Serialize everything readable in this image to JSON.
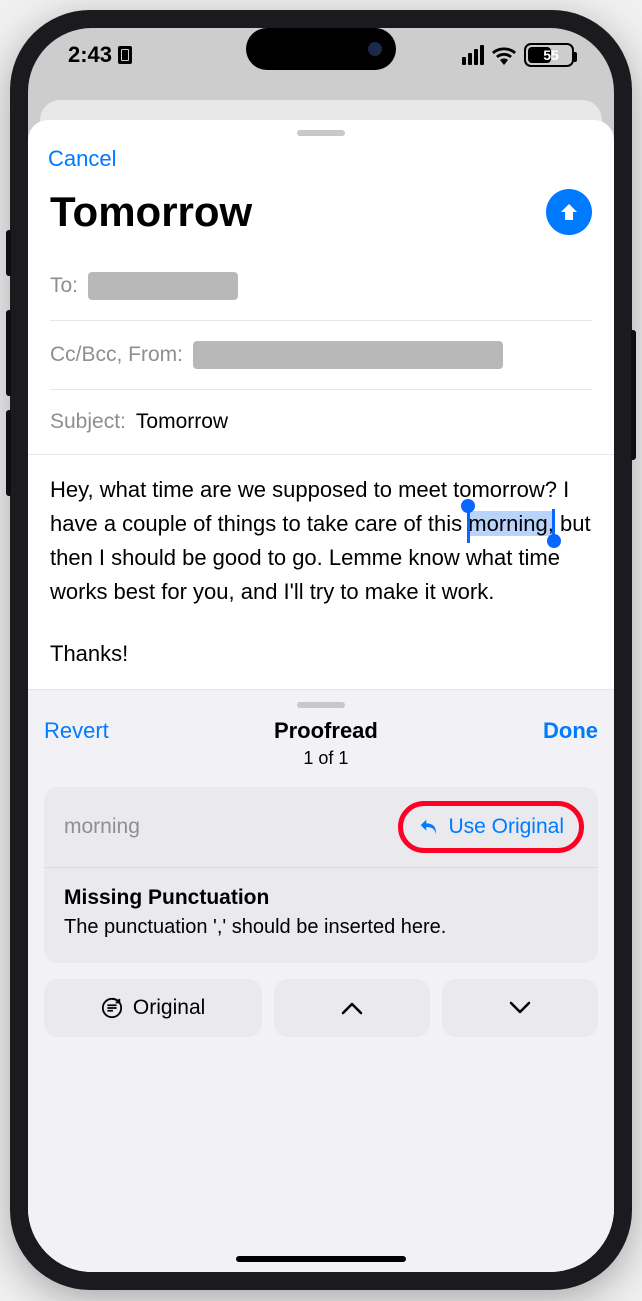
{
  "status": {
    "time": "2:43",
    "battery_pct": "55"
  },
  "compose": {
    "cancel": "Cancel",
    "title": "Tomorrow",
    "to_label": "To:",
    "ccbcc_label": "Cc/Bcc, From:",
    "subject_label": "Subject:",
    "subject_value": "Tomorrow",
    "body_before": "Hey, what time are we supposed to meet tomorrow? I have a couple of things to take care of this ",
    "body_selected": "morning,",
    "body_after": " but then I should be good to go. Lemme know what time works best for you, and I'll try to make it work.",
    "body_thanks": "Thanks!"
  },
  "proofread": {
    "revert": "Revert",
    "title": "Proofread",
    "count": "1 of 1",
    "done": "Done",
    "word": "morning",
    "use_original": "Use Original",
    "issue_title": "Missing Punctuation",
    "issue_desc": "The punctuation ',' should be inserted here.",
    "original_btn": "Original"
  }
}
